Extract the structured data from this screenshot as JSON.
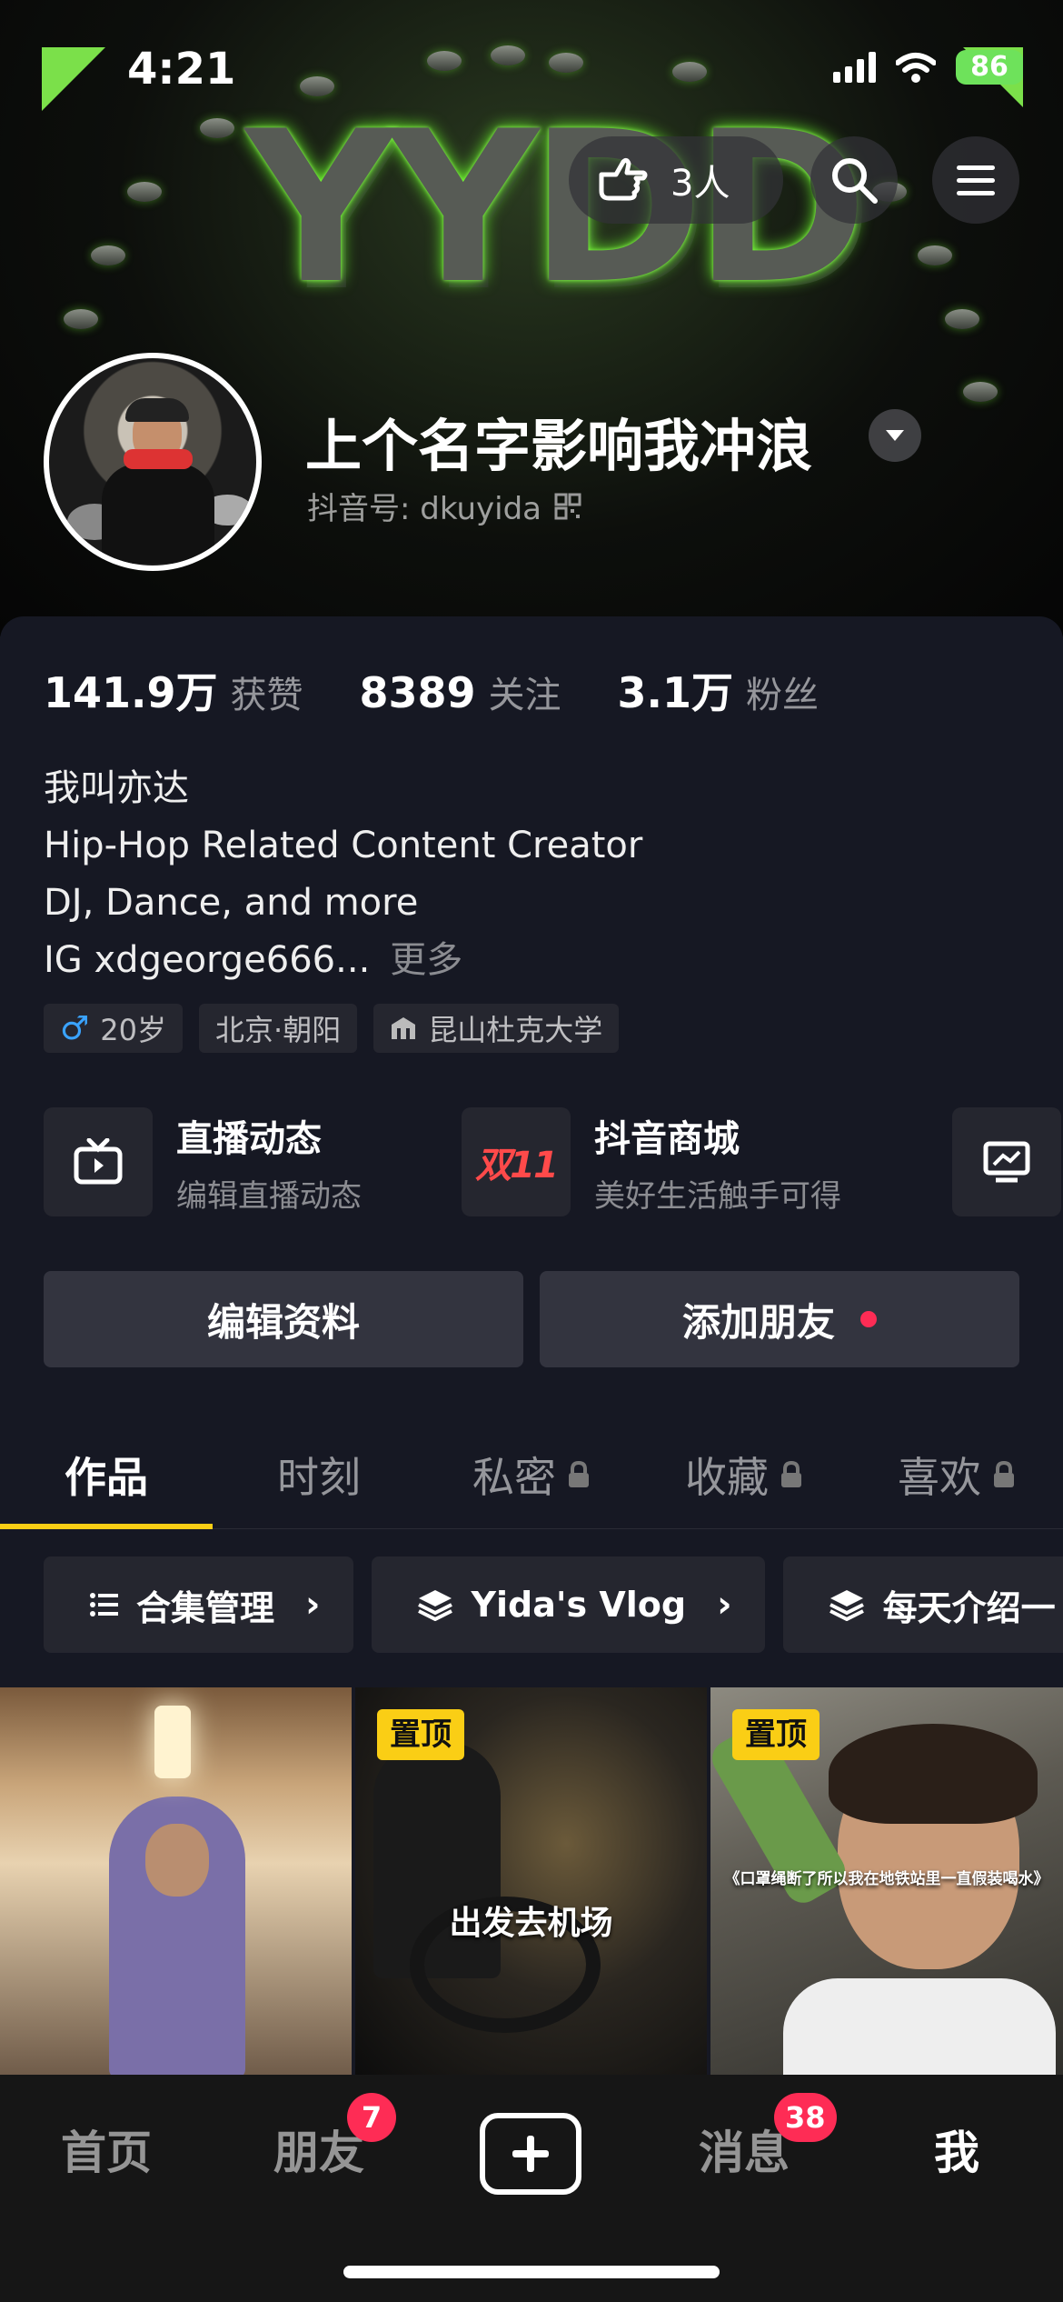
{
  "status_bar": {
    "time": "4:21",
    "battery": "86"
  },
  "banner": {
    "art_text": "YYDD"
  },
  "header": {
    "visitors": "3人",
    "nickname": "上个名字影响我冲浪",
    "douyin_id_label": "抖音号: dkuyida"
  },
  "stats": [
    {
      "value": "141.9万",
      "label": "获赞"
    },
    {
      "value": "8389",
      "label": "关注"
    },
    {
      "value": "3.1万",
      "label": "粉丝"
    }
  ],
  "bio": {
    "lines": [
      "我叫亦达",
      "Hip-Hop Related Content Creator",
      "DJ, Dance, and more",
      "IG xdgeorge666..."
    ],
    "more": "更多"
  },
  "tags": {
    "age": "20岁",
    "location": "北京·朝阳",
    "school": "昆山杜克大学"
  },
  "services": [
    {
      "title": "直播动态",
      "subtitle": "编辑直播动态",
      "icon": "tv-icon"
    },
    {
      "title": "抖音商城",
      "subtitle": "美好生活触手可得",
      "icon_text": "双11"
    },
    {
      "icon": "chart-icon"
    }
  ],
  "actions": {
    "edit_profile": "编辑资料",
    "add_friend": "添加朋友"
  },
  "tabs": [
    "作品",
    "时刻",
    "私密",
    "收藏",
    "喜欢"
  ],
  "collections": [
    "合集管理",
    "Yida's Vlog",
    "每天介绍一"
  ],
  "videos": [
    {
      "pinned": false,
      "caption": ""
    },
    {
      "pinned": true,
      "pin_label": "置顶",
      "caption": "出发去机场"
    },
    {
      "pinned": true,
      "pin_label": "置顶",
      "caption": "《口罩绳断了所以我在地铁站里一直假装喝水》"
    }
  ],
  "bottom_nav": {
    "home": "首页",
    "friends": "朋友",
    "friends_badge": "7",
    "messages": "消息",
    "messages_badge": "38",
    "me": "我"
  },
  "colors": {
    "accent": "#face15",
    "badge_red": "#fe2c55",
    "background": "#161823"
  }
}
